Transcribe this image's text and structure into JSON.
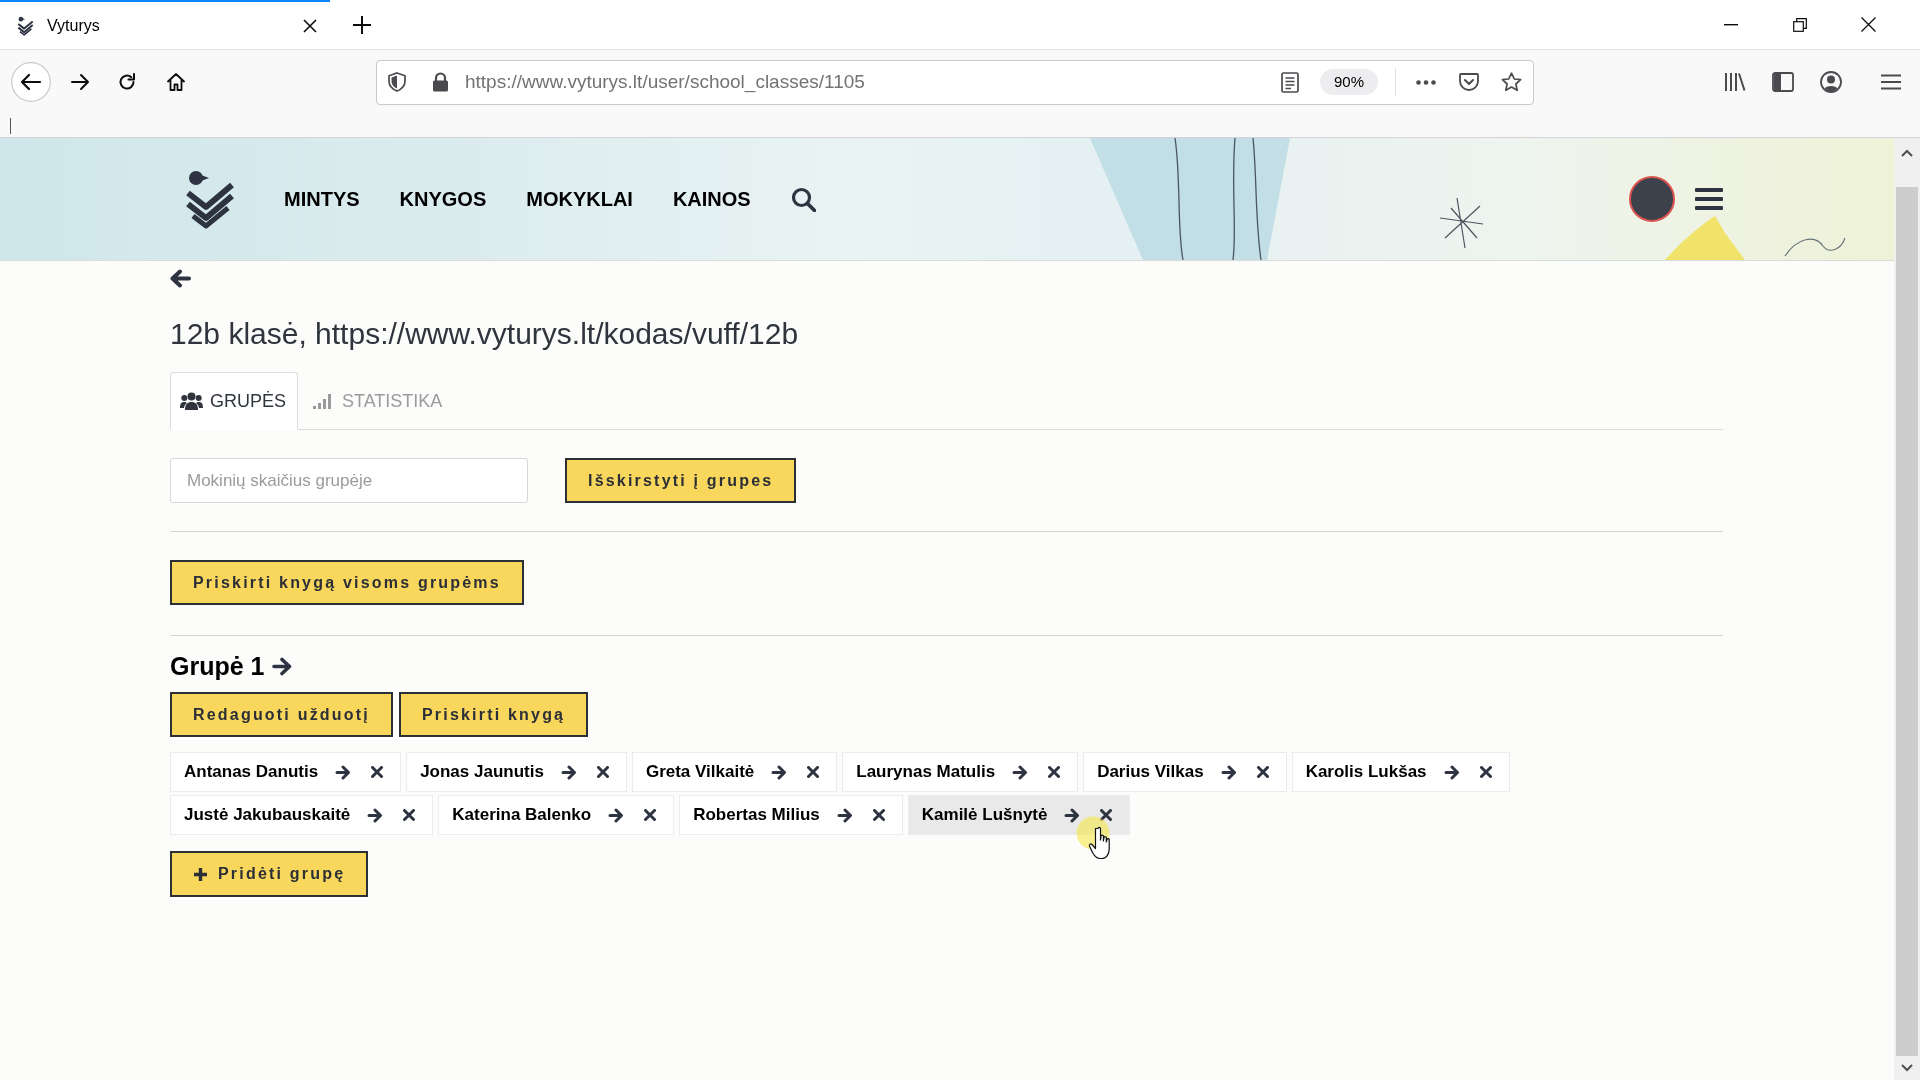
{
  "browser": {
    "tabs": [
      {
        "title": "Vyturys",
        "selected": true
      }
    ],
    "address": {
      "prefix": "https://www.",
      "domain": "vyturys.lt",
      "path": "/user/school_classes/1105"
    },
    "zoom": "90%"
  },
  "header": {
    "nav": [
      "MINTYS",
      "KNYGOS",
      "MOKYKLAI",
      "KAINOS"
    ]
  },
  "page": {
    "title": "12b klasė, https://www.vyturys.lt/kodas/vuff/12b",
    "tabs": [
      {
        "label": "GRUPĖS",
        "selected": true
      },
      {
        "label": "STATISTIKA",
        "selected": false
      }
    ],
    "group_size_field": {
      "placeholder": "Mokinių skaičius grupėje"
    },
    "distribute_button": "Išskirstyti į grupes",
    "assign_all_button": "Priskirti knygą visoms grupėms",
    "groups": [
      {
        "title": "Grupė 1",
        "buttons": [
          "Redaguoti užduotį",
          "Priskirti knygą"
        ],
        "students": [
          {
            "name": "Antanas Danutis",
            "highlighted": false
          },
          {
            "name": "Jonas Jaunutis",
            "highlighted": false
          },
          {
            "name": "Greta Vilkaitė",
            "highlighted": false
          },
          {
            "name": "Laurynas Matulis",
            "highlighted": false
          },
          {
            "name": "Darius Vilkas",
            "highlighted": false
          },
          {
            "name": "Karolis Lukšas",
            "highlighted": false
          },
          {
            "name": "Justė Jakubauskaitė",
            "highlighted": false
          },
          {
            "name": "Katerina Balenko",
            "highlighted": false
          },
          {
            "name": "Robertas Milius",
            "highlighted": false
          },
          {
            "name": "Kamilė Lušnytė",
            "highlighted": true
          }
        ]
      }
    ],
    "add_group_button": "Pridėti grupę"
  }
}
